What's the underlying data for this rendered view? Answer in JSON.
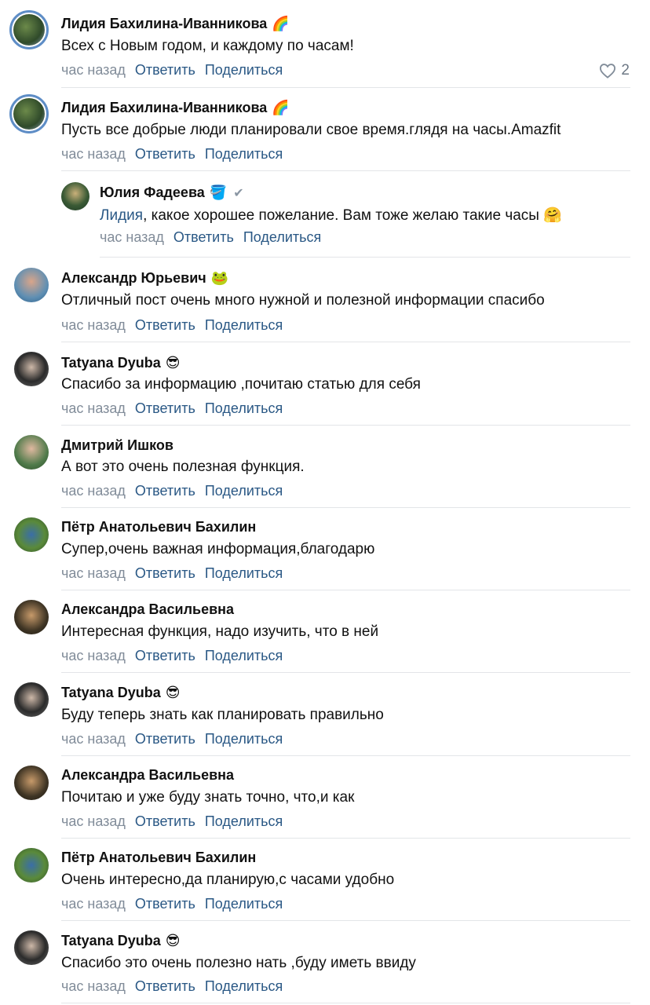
{
  "common": {
    "time": "час назад",
    "reply": "Ответить",
    "share": "Поделиться"
  },
  "comments": [
    {
      "name": "Лидия Бахилина-Иванникова",
      "badge": "🌈",
      "text": "Всех с Новым годом, и каждому по часам!",
      "likes": "2"
    },
    {
      "name": "Лидия Бахилина-Иванникова",
      "badge": "🌈",
      "text": "Пусть все добрые люди планировали свое время.глядя на часы.Amazfit"
    },
    {
      "name": "Юлия Фадеева",
      "badge": "🪣",
      "verified": "✔",
      "mention": "Лидия",
      "text": ", какое хорошее пожелание. Вам тоже желаю такие часы 🤗"
    },
    {
      "name": "Александр Юрьевич",
      "badge": "🐸",
      "text": "Отличный пост очень много нужной и полезной информации спасибо"
    },
    {
      "name": "Tatyana Dyuba",
      "badge": "😎",
      "text": "Спасибо за информацию ,почитаю статью для себя"
    },
    {
      "name": "Дмитрий Ишков",
      "text": "А вот это очень полезная функция."
    },
    {
      "name": "Пётр Анатольевич Бахилин",
      "text": "Супер,очень важная информация,благодарю"
    },
    {
      "name": "Александра Васильевна",
      "text": "Интересная функция, надо изучить, что в ней"
    },
    {
      "name": "Tatyana Dyuba",
      "badge": "😎",
      "text": "Буду теперь знать как планировать правильно"
    },
    {
      "name": "Александра Васильевна",
      "text": "Почитаю и уже буду знать точно, что,и как"
    },
    {
      "name": "Пётр Анатольевич Бахилин",
      "text": "Очень интересно,да планирую,с часами удобно"
    },
    {
      "name": "Tatyana Dyuba",
      "badge": "😎",
      "text": "Спасибо это очень полезно нать ,буду иметь ввиду"
    }
  ]
}
